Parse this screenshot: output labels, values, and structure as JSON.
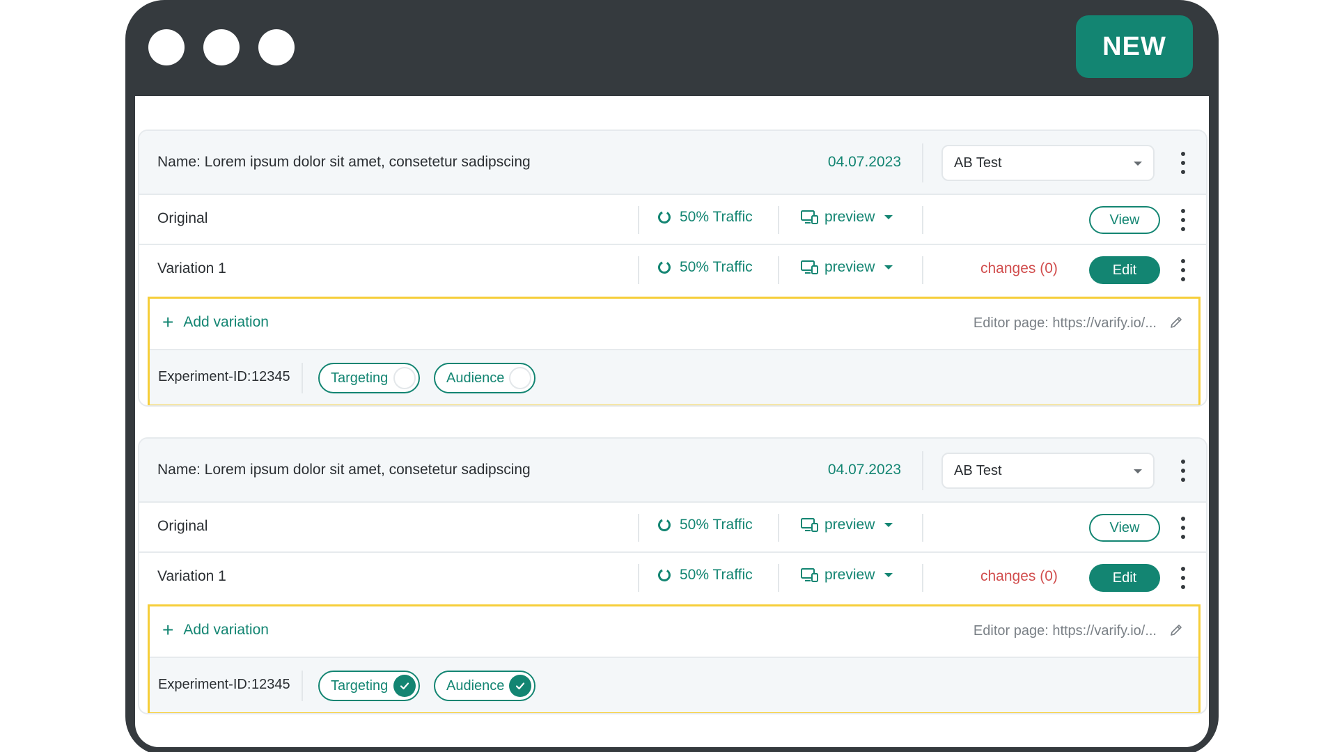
{
  "window": {
    "badge": "NEW"
  },
  "experiments": [
    {
      "name": "Name: Lorem ipsum dolor sit amet, consetetur sadipscing",
      "date": "04.07.2023",
      "type": "AB Test",
      "original": {
        "label": "Original",
        "traffic": "50% Traffic",
        "preview": "preview",
        "action": "View"
      },
      "variation": {
        "label": "Variation 1",
        "traffic": "50% Traffic",
        "preview": "preview",
        "changes": "changes (0)",
        "action": "Edit"
      },
      "add_variation": "Add variation",
      "editor_page": "Editor page: https://varify.io/...",
      "experiment_id_label": "Experiment-ID:",
      "experiment_id": "12345",
      "targeting": "Targeting",
      "audience": "Audience",
      "targeting_enabled": false,
      "audience_enabled": false
    },
    {
      "name": "Name: Lorem ipsum dolor sit amet, consetetur sadipscing",
      "date": "04.07.2023",
      "type": "AB Test",
      "original": {
        "label": "Original",
        "traffic": "50% Traffic",
        "preview": "preview",
        "action": "View"
      },
      "variation": {
        "label": "Variation 1",
        "traffic": "50% Traffic",
        "preview": "preview",
        "changes": "changes (0)",
        "action": "Edit"
      },
      "add_variation": "Add variation",
      "editor_page": "Editor page: https://varify.io/...",
      "experiment_id_label": "Experiment-ID:",
      "experiment_id": "12345",
      "targeting": "Targeting",
      "audience": "Audience",
      "targeting_enabled": true,
      "audience_enabled": true
    }
  ],
  "colors": {
    "accent": "#138572",
    "danger": "#d14d4d",
    "highlight": "#f6ce3a",
    "frame": "#353a3e"
  }
}
